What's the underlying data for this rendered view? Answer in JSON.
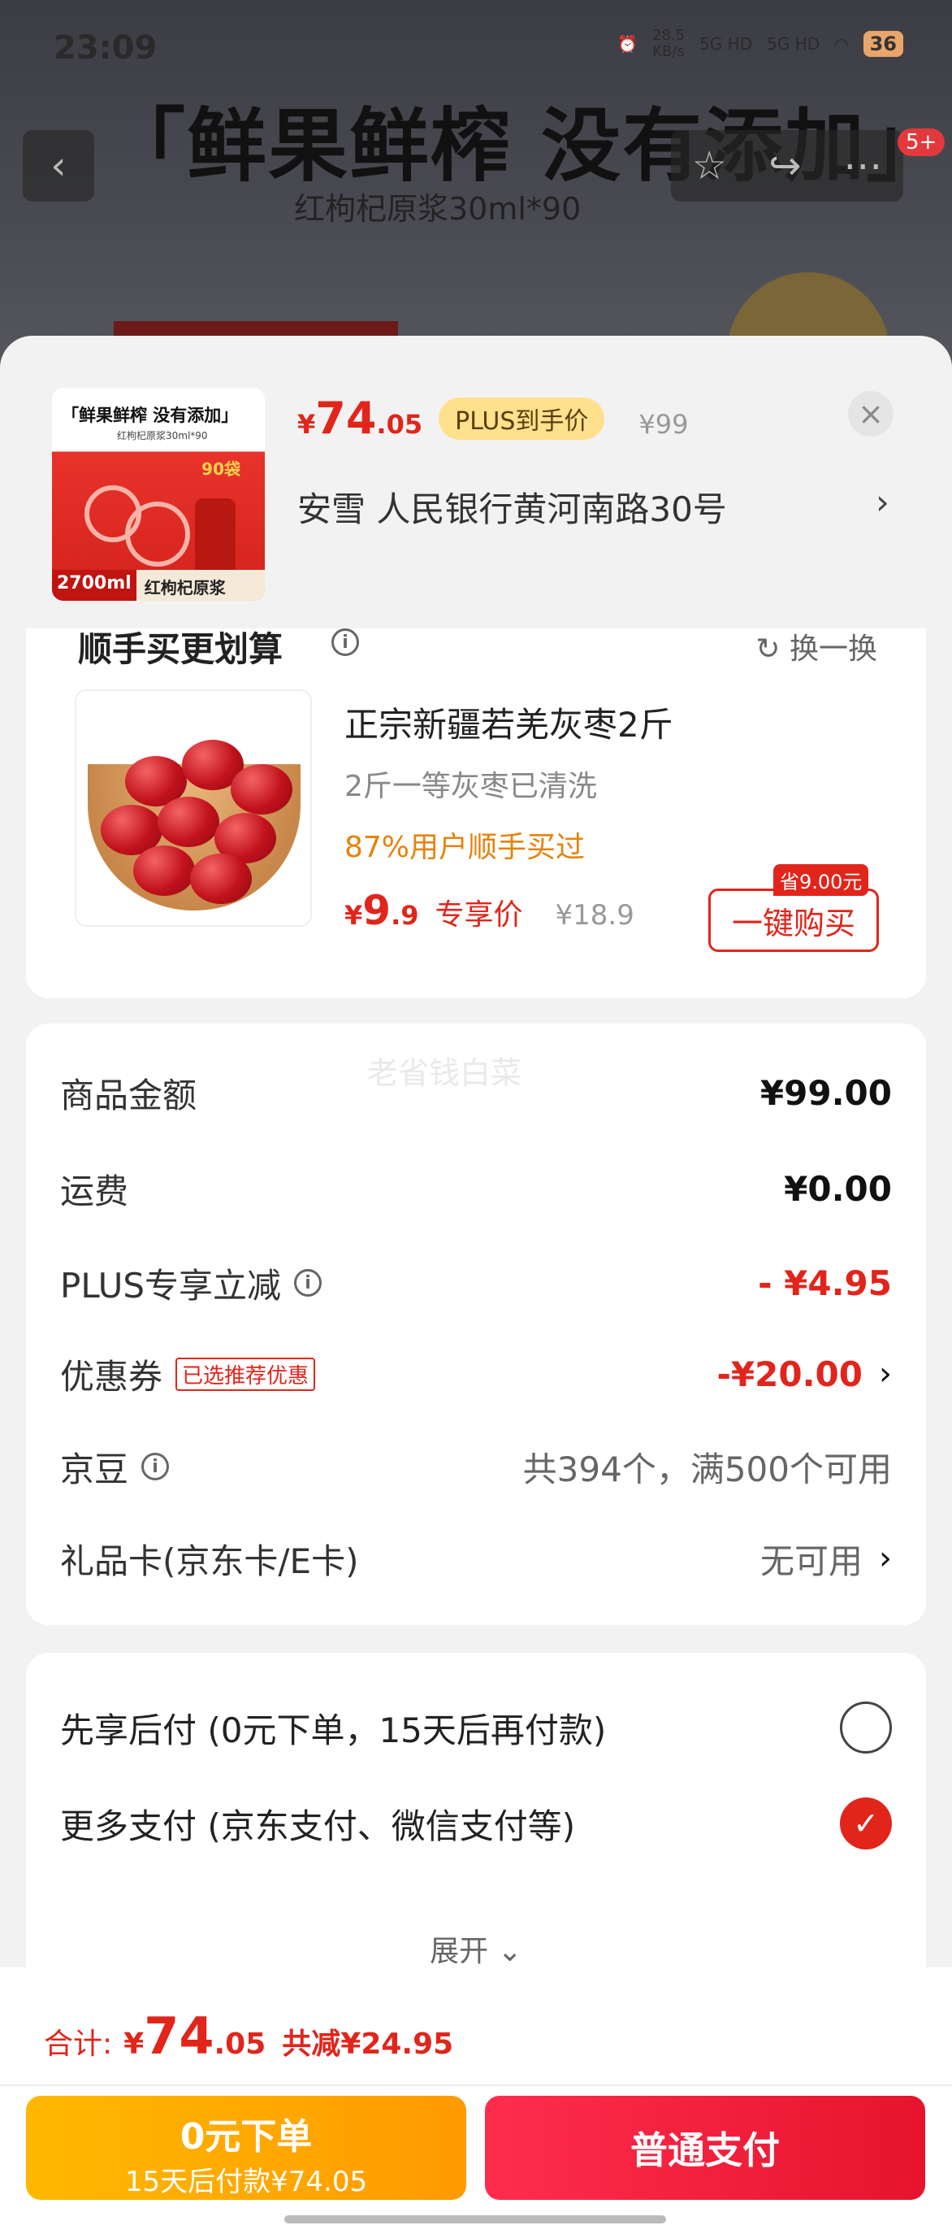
{
  "status_bar": {
    "time": "23:09",
    "net_speed_value": "28.5",
    "net_speed_unit": "KB/s",
    "signal1": "5G HD",
    "signal2": "5G HD",
    "battery": "36"
  },
  "background": {
    "banner": "「鲜果鲜榨  没有添加」",
    "subtitle": "红枸杞原浆30ml*90",
    "badge": "5+"
  },
  "product": {
    "image_title": "「鲜果鲜榨  没有添加」",
    "image_sub": "红枸杞原浆30ml*90",
    "image_tag": "90袋",
    "image_volume": "2700ml",
    "image_name": "红枸杞原浆",
    "price_yen": "¥",
    "price_int": "74",
    "price_dec": ".05",
    "plus_tag": "PLUS到手价",
    "original_price": "¥99",
    "address": "安雪  人民银行黄河南路30号"
  },
  "addon": {
    "title": "顺手买更划算",
    "swap": "换一换",
    "name": "正宗新疆若羌灰枣2斤",
    "desc": "2斤一等灰枣已清洗",
    "bought": "87%用户顺手买过",
    "price_yen": "¥",
    "price_int": "9",
    "price_dec": ".9",
    "price_label": "专享价",
    "orig": "¥18.9",
    "save_badge": "省9.00元",
    "buy_btn": "一键购买"
  },
  "summary": {
    "watermark": "老省钱白菜",
    "rows": [
      {
        "label": "商品金额",
        "value": "¥99.00"
      },
      {
        "label": "运费",
        "value": "¥0.00"
      },
      {
        "label": "PLUS专享立减",
        "value": "- ¥4.95"
      },
      {
        "label": "优惠券",
        "tag": "已选推荐优惠",
        "value": "-¥20.00"
      },
      {
        "label": "京豆",
        "value": "共394个，满500个可用"
      },
      {
        "label": "礼品卡(京东卡/E卡)",
        "value": "无可用"
      }
    ]
  },
  "payment": {
    "options": [
      {
        "label": "先享后付 (0元下单，15天后再付款)",
        "selected": false
      },
      {
        "label": "更多支付 (京东支付、微信支付等)",
        "selected": true
      }
    ],
    "expand": "展开"
  },
  "footer": {
    "total_label": "合计:",
    "total_yen": "¥",
    "total_int": "74",
    "total_dec": ".05",
    "total_save": "共减¥24.95",
    "btn_later_line1": "0元下单",
    "btn_later_line2": "15天后付款¥74.05",
    "btn_pay": "普通支付"
  },
  "colors": {
    "accent": "#e1251b",
    "plus_tag_bg": "#ffe08d",
    "later_btn": "#ffb800",
    "pay_btn": "#ff2d4d"
  }
}
